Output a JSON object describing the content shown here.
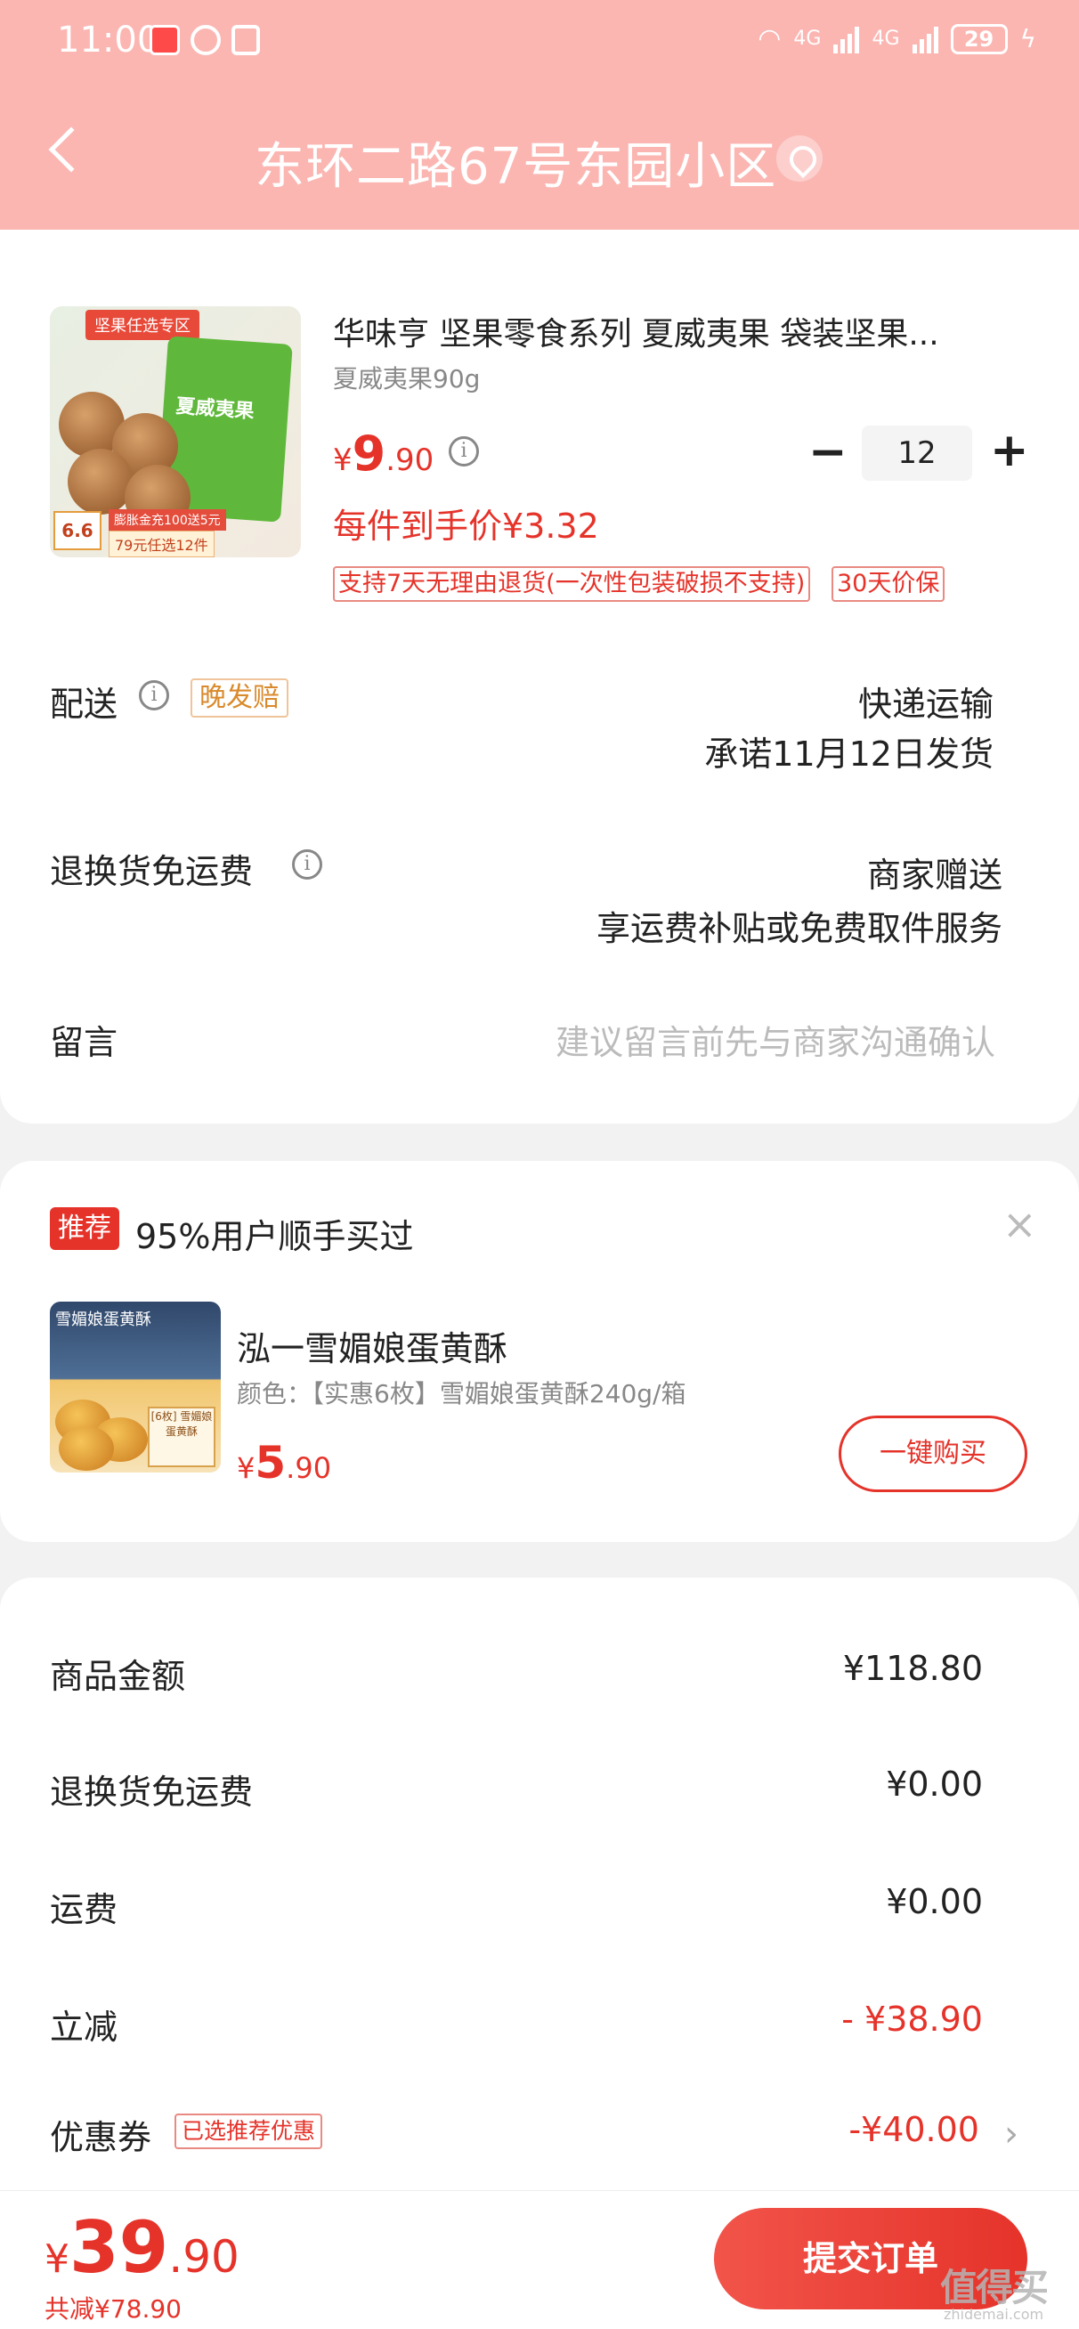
{
  "status_bar": {
    "time": "11:00",
    "battery": "29",
    "net1": "4G",
    "net2": "4G"
  },
  "header": {
    "address": "东环二路67号东园小区"
  },
  "product": {
    "title": "华味亨 坚果零食系列 夏威夷果 袋装坚果...",
    "spec": "夏威夷果90g",
    "price_currency": "¥",
    "price_int": "9",
    "price_dec": ".90",
    "unit_price": "每件到手价¥3.32",
    "quantity": "12",
    "service1": "支持7天无理由退货(一次性包装破损不支持)",
    "service2": "30天价保",
    "image_text": {
      "tag": "坚果任选专区",
      "pack_name": "夏威夷果",
      "promo1": "膨胀金充100送5元",
      "promo2": "79元任选12件",
      "badge": "6.6"
    }
  },
  "delivery": {
    "label": "配送",
    "tag": "晚发赔",
    "method": "快递运输",
    "promise": "承诺11月12日发货"
  },
  "return_shipping": {
    "label": "退换货免运费",
    "line1": "商家赠送",
    "line2": "享运费补贴或免费取件服务"
  },
  "message": {
    "label": "留言",
    "placeholder": "建议留言前先与商家沟通确认"
  },
  "recommend": {
    "tag": "推荐",
    "title": "95%用户顺手买过",
    "name": "泓一雪媚娘蛋黄酥",
    "spec": "颜色：【实惠6枚】雪媚娘蛋黄酥240g/箱",
    "price_currency": "¥",
    "price_int": "5",
    "price_dec": ".90",
    "buy_label": "一键购买",
    "image_text": {
      "title": "雪媚娘蛋黄酥",
      "box": "[6枚] 雪媚娘蛋黄酥"
    }
  },
  "summary": {
    "items": [
      {
        "label": "商品金额",
        "value": "¥118.80"
      },
      {
        "label": "退换货免运费",
        "value": "¥0.00"
      },
      {
        "label": "运费",
        "value": "¥0.00"
      },
      {
        "label": "立减",
        "value": "- ¥38.90"
      },
      {
        "label": "优惠券",
        "value": "-¥40.00"
      }
    ],
    "coupon_tag": "已选推荐优惠"
  },
  "footer": {
    "currency": "¥",
    "total_int": "39",
    "total_dec": ".90",
    "saved": "共减¥78.90",
    "submit_label": "提交订单",
    "watermark": "值得买",
    "watermark_small": "zhidemai.com"
  },
  "colors": {
    "header_bg": "#fbb6b2",
    "accent_red": "#e5332a",
    "late_tag": "#d98a2c"
  }
}
